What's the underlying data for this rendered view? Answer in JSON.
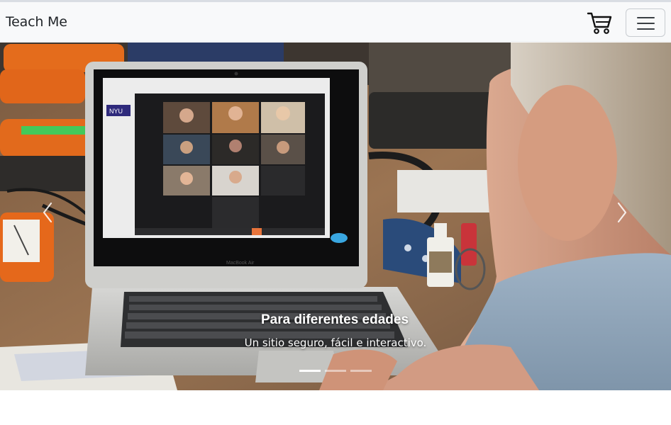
{
  "navbar": {
    "brand": "Teach Me",
    "icons": {
      "cart": "shopping-cart-icon",
      "menu": "hamburger-menu-icon"
    }
  },
  "carousel": {
    "slide": {
      "title": "Para diferentes edades",
      "subtitle": "Un sitio seguro, fácil e interactivo."
    },
    "indicators": [
      {
        "active": true
      },
      {
        "active": false
      },
      {
        "active": false
      }
    ],
    "icons": {
      "prev": "chevron-left-icon",
      "next": "chevron-right-icon"
    },
    "screen_text": {
      "brand_badge": "NYU",
      "laptop_label": "MacBook Air"
    }
  },
  "colors": {
    "navbar_bg": "#f8f9fa",
    "caption_text": "#ffffff"
  }
}
